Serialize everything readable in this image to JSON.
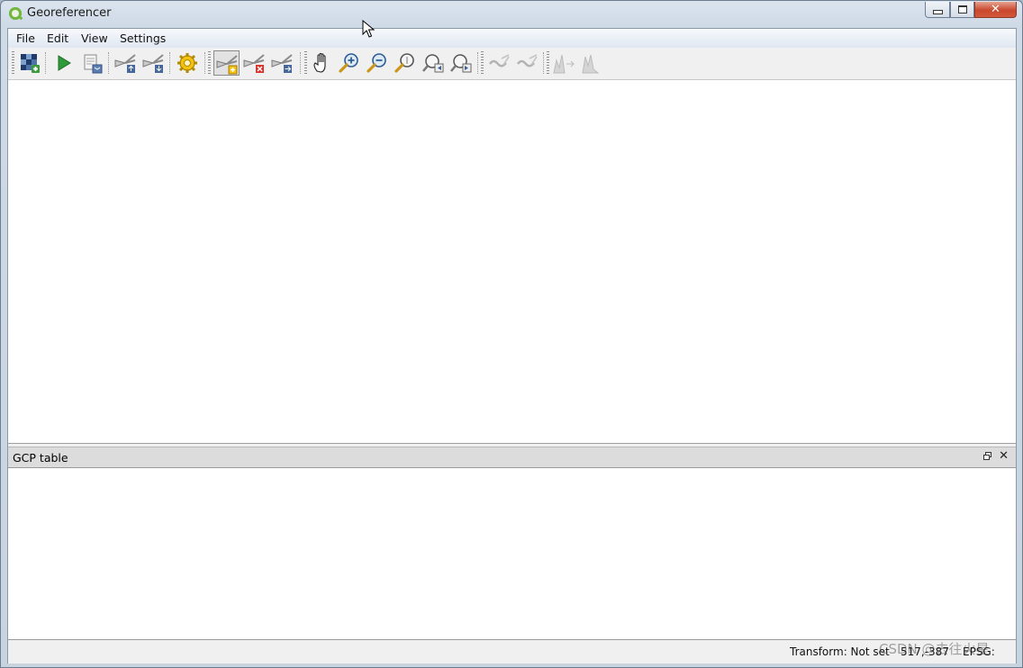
{
  "window": {
    "title": "Georeferencer"
  },
  "menu": {
    "file": "File",
    "edit": "Edit",
    "view": "View",
    "settings": "Settings"
  },
  "toolbar": {
    "items": [
      "open-raster-icon",
      "start-georeferencing-icon",
      "generate-gdal-script-icon",
      "load-gcp-points-icon",
      "save-gcp-points-icon",
      "transformation-settings-icon",
      "add-point-icon",
      "delete-point-icon",
      "move-gcp-point-icon",
      "pan-icon",
      "zoom-in-icon",
      "zoom-out-icon",
      "zoom-to-layer-icon",
      "zoom-last-icon",
      "zoom-next-icon",
      "link-georeferencer-to-qgis-icon",
      "link-qgis-to-georeferencer-icon",
      "full-histogram-stretch-icon",
      "local-histogram-stretch-icon"
    ]
  },
  "gcp_panel": {
    "title": "GCP table"
  },
  "status": {
    "transform": "Transform: Not set",
    "coords": "517,-387",
    "crs": "EPSG:"
  },
  "watermark": "CSDN @去往火星"
}
